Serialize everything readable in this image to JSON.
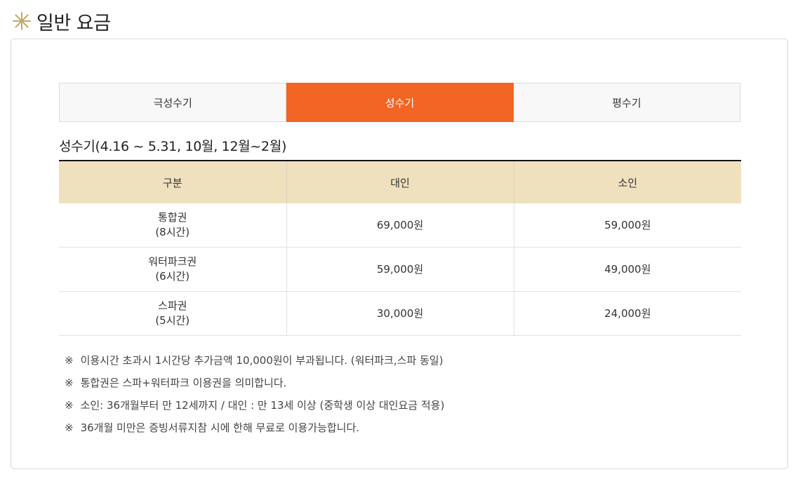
{
  "header": {
    "title": "일반 요금",
    "icon": "sparkle-icon",
    "icon_color": "#c9a56a"
  },
  "tabs": [
    {
      "label": "극성수기",
      "active": false
    },
    {
      "label": "성수기",
      "active": true
    },
    {
      "label": "평수기",
      "active": false
    }
  ],
  "accent_color": "#f26524",
  "section_title": "성수기(4.16 ~ 5.31, 10월, 12월~2월)",
  "table": {
    "header_color": "#efe0be",
    "headers": [
      "구분",
      "대인",
      "소인"
    ],
    "rows": [
      {
        "ticket": "통합권",
        "duration": "(8시간)",
        "adult": "69,000원",
        "child": "59,000원"
      },
      {
        "ticket": "워터파크권",
        "duration": "(6시간)",
        "adult": "59,000원",
        "child": "49,000원"
      },
      {
        "ticket": "스파권",
        "duration": "(5시간)",
        "adult": "30,000원",
        "child": "24,000원"
      }
    ]
  },
  "note_mark": "※",
  "notes": [
    "이용시간 초과시 1시간당 추가금액 10,000원이 부과됩니다. (워터파크,스파 동일)",
    "통합권은 스파+워터파크 이용권을 의미합니다.",
    "소인: 36개월부터 만 12세까지 / 대인 : 만 13세 이상 (중학생 이상 대인요금 적용)",
    "36개월 미만은 증빙서류지참 시에 한해 무료로 이용가능합니다."
  ]
}
